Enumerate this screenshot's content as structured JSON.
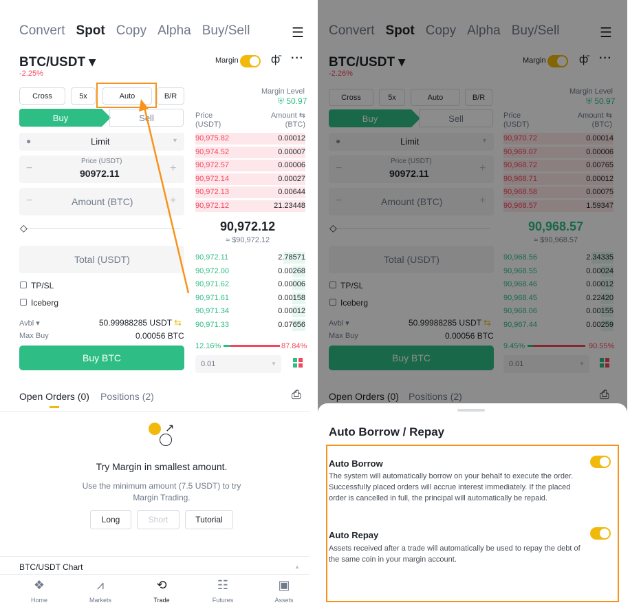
{
  "tabs": [
    "Convert",
    "Spot",
    "Copy",
    "Alpha",
    "Buy/Sell"
  ],
  "pair": "BTC/USDT ▾",
  "margin_label": "Margin",
  "mode_buttons": [
    "Cross",
    "5x",
    "Auto",
    "B/R"
  ],
  "margin_level_label": "Margin Level",
  "buy_label": "Buy",
  "sell_label": "Sell",
  "order_type": "Limit",
  "price_label": "Price (USDT)",
  "amount_label": "Amount (BTC)",
  "total_label": "Total (USDT)",
  "tpsl": "TP/SL",
  "iceberg": "Iceberg",
  "avbl_label": "Avbl ▾",
  "avbl_value": "50.99988285 USDT",
  "maxbuy_label": "Max Buy",
  "maxbuy_value": "0.00056 BTC",
  "buy_button": "Buy BTC",
  "ob_price_head": "Price\n(USDT)",
  "ob_amount_head": "Amount ⇆\n(BTC)",
  "depth": "0.01",
  "open_orders": "Open Orders (0)",
  "positions": "Positions (2)",
  "empty_title": "Try Margin in smallest amount.",
  "empty_desc": "Use the minimum amount (7.5 USDT) to try Margin Trading.",
  "empty_buttons": [
    "Long",
    "Short",
    "Tutorial"
  ],
  "chart_label": "BTC/USDT Chart",
  "nav": [
    "Home",
    "Markets",
    "Trade",
    "Futures",
    "Assets"
  ],
  "left": {
    "change": "-2.25%",
    "margin_level": "50.97",
    "price": "90972.11",
    "asks": [
      [
        "90,975.82",
        "0.00012"
      ],
      [
        "90,974.52",
        "0.00007"
      ],
      [
        "90,972.57",
        "0.00006"
      ],
      [
        "90,972.14",
        "0.00027"
      ],
      [
        "90,972.13",
        "0.00644"
      ],
      [
        "90,972.12",
        "21.23448"
      ]
    ],
    "last": "90,972.12",
    "last_usd": "≈ $90,972.12",
    "bids": [
      [
        "90,972.11",
        "2.78571"
      ],
      [
        "90,972.00",
        "0.00268"
      ],
      [
        "90,971.62",
        "0.00006"
      ],
      [
        "90,971.61",
        "0.00158"
      ],
      [
        "90,971.34",
        "0.00012"
      ],
      [
        "90,971.33",
        "0.07656"
      ]
    ],
    "buy_pct": "12.16%",
    "sell_pct": "87.84%",
    "buy_ratio": 0.1216
  },
  "right": {
    "change": "-2.26%",
    "margin_level": "50.97",
    "price": "90972.11",
    "asks": [
      [
        "90,970.72",
        "0.00014"
      ],
      [
        "90,969.07",
        "0.00006"
      ],
      [
        "90,968.72",
        "0.00765"
      ],
      [
        "90,968.71",
        "0.00012"
      ],
      [
        "90,968.58",
        "0.00075"
      ],
      [
        "90,968.57",
        "1.59347"
      ]
    ],
    "last": "90,968.57",
    "last_usd": "≈ $90,968.57",
    "bids": [
      [
        "90,968.56",
        "2.34335"
      ],
      [
        "90,968.55",
        "0.00024"
      ],
      [
        "90,968.46",
        "0.00012"
      ],
      [
        "90,968.45",
        "0.22420"
      ],
      [
        "90,968.06",
        "0.00155"
      ],
      [
        "90,967.44",
        "0.00259"
      ]
    ],
    "buy_pct": "9.45%",
    "sell_pct": "90.55%",
    "buy_ratio": 0.0945
  },
  "sheet": {
    "title": "Auto Borrow / Repay",
    "borrow_title": "Auto Borrow",
    "borrow_desc": "The system will automatically borrow on your behalf to execute the order. Successfully placed orders will accrue interest immediately. If the placed order is cancelled in full, the principal will automatically be repaid.",
    "repay_title": "Auto Repay",
    "repay_desc": "Assets received after a trade will automatically be used to repay the debt of the same coin in your margin account."
  },
  "colors": {
    "accent": "#f0b90b",
    "buy": "#2ebd85",
    "sell": "#f6465d",
    "highlight": "#f7931a"
  }
}
